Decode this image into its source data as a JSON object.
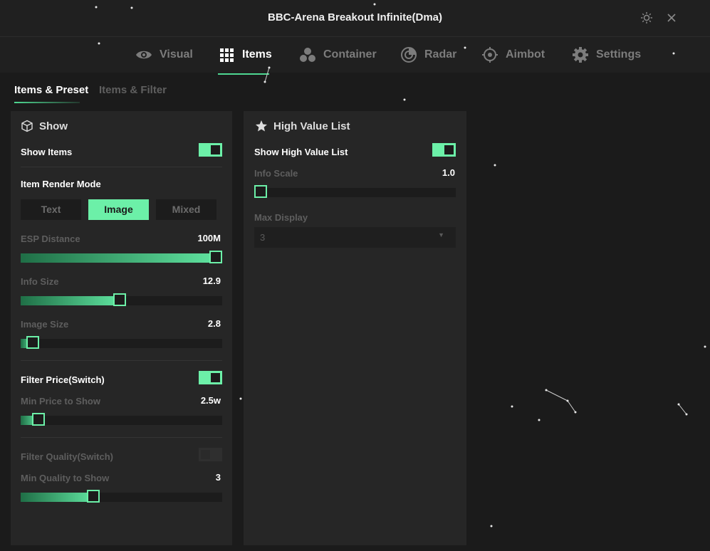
{
  "window": {
    "title": "BBC-Arena Breakout Infinite(Dma)",
    "theme_icon": "sun-icon",
    "close_icon": "close-icon"
  },
  "nav": {
    "tabs": [
      {
        "label": "Visual",
        "icon": "eye-icon"
      },
      {
        "label": "Items",
        "icon": "grid-icon",
        "active": true
      },
      {
        "label": "Container",
        "icon": "cluster-icon"
      },
      {
        "label": "Radar",
        "icon": "radar-icon"
      },
      {
        "label": "Aimbot",
        "icon": "crosshair-icon"
      },
      {
        "label": "Settings",
        "icon": "gear-icon"
      }
    ]
  },
  "subtabs": [
    {
      "label": "Items & Preset",
      "active": true
    },
    {
      "label": "Items & Filter",
      "active": false
    }
  ],
  "show_panel": {
    "header": "Show",
    "header_icon": "cube-icon",
    "show_items": {
      "label": "Show Items",
      "on": true
    },
    "render_mode": {
      "label": "Item Render Mode",
      "options": [
        "Text",
        "Image",
        "Mixed"
      ],
      "selected": "Image"
    },
    "esp_distance": {
      "label": "ESP Distance",
      "value": "100M",
      "fraction": 1.0
    },
    "info_size": {
      "label": "Info Size",
      "value": "12.9",
      "fraction": 0.49
    },
    "image_size": {
      "label": "Image Size",
      "value": "2.8",
      "fraction": 0.03
    },
    "filter_price": {
      "label": "Filter Price(Switch)",
      "on": true
    },
    "min_price": {
      "label": "Min Price to Show",
      "value": "2.5w",
      "fraction": 0.06
    },
    "filter_quality": {
      "label": "Filter Quality(Switch)",
      "on": false
    },
    "min_quality": {
      "label": "Min Quality to Show",
      "value": "3",
      "fraction": 0.35
    }
  },
  "high_value_panel": {
    "header": "High Value List",
    "header_icon": "star-icon",
    "show_list": {
      "label": "Show High Value List",
      "on": true
    },
    "info_scale": {
      "label": "Info Scale",
      "value": "1.0",
      "fraction": 0.0
    },
    "max_display": {
      "label": "Max Display",
      "value": "3"
    }
  },
  "colors": {
    "accent": "#6cf0a8",
    "background": "#1b1b1b",
    "panel": "#262626"
  }
}
